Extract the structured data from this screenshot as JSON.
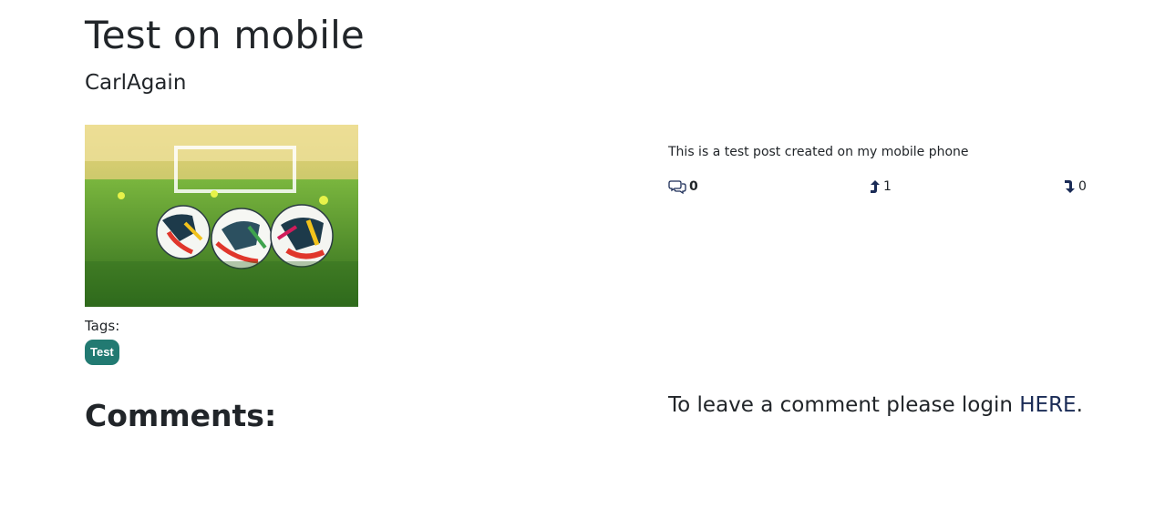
{
  "post": {
    "title": "Test on mobile",
    "author": "CarlAgain",
    "excerpt": "This is a test post created on my mobile phone",
    "image_alt": "soccer balls on a green pitch"
  },
  "stats": {
    "comments": "0",
    "upvotes": "1",
    "downvotes": "0"
  },
  "tags": {
    "label": "Tags:",
    "items": [
      "Test"
    ]
  },
  "comments": {
    "heading": "Comments:",
    "login_prefix": "To leave a comment please login ",
    "login_link": "HERE",
    "login_suffix": "."
  },
  "colors": {
    "tag_bg": "#227a72",
    "link": "#1a2b56",
    "icon": "#1a2b56"
  },
  "icons": {
    "comments": "chat-bubbles-icon",
    "upvote": "arrow-up-turn-icon",
    "downvote": "arrow-down-turn-icon"
  }
}
